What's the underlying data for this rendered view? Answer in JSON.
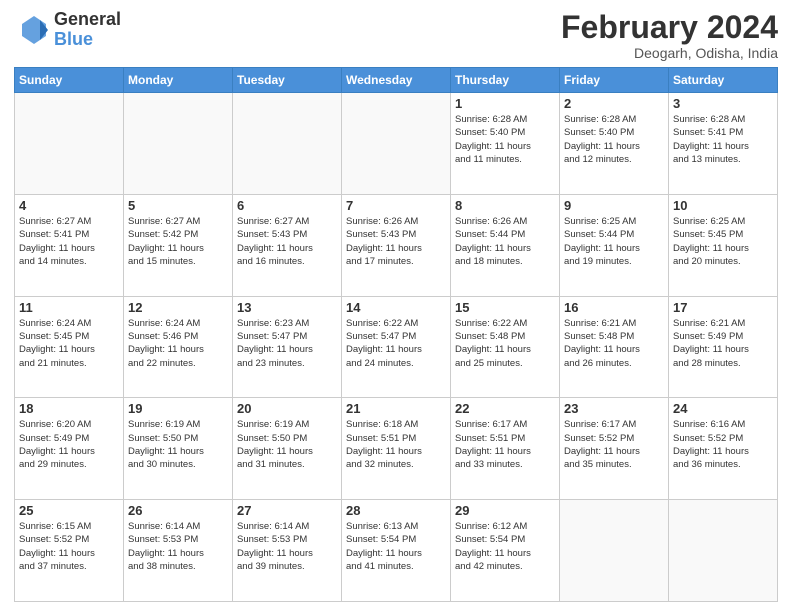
{
  "header": {
    "logo_general": "General",
    "logo_blue": "Blue",
    "title": "February 2024",
    "subtitle": "Deogarh, Odisha, India"
  },
  "days_of_week": [
    "Sunday",
    "Monday",
    "Tuesday",
    "Wednesday",
    "Thursday",
    "Friday",
    "Saturday"
  ],
  "weeks": [
    [
      {
        "day": "",
        "info": ""
      },
      {
        "day": "",
        "info": ""
      },
      {
        "day": "",
        "info": ""
      },
      {
        "day": "",
        "info": ""
      },
      {
        "day": "1",
        "info": "Sunrise: 6:28 AM\nSunset: 5:40 PM\nDaylight: 11 hours\nand 11 minutes."
      },
      {
        "day": "2",
        "info": "Sunrise: 6:28 AM\nSunset: 5:40 PM\nDaylight: 11 hours\nand 12 minutes."
      },
      {
        "day": "3",
        "info": "Sunrise: 6:28 AM\nSunset: 5:41 PM\nDaylight: 11 hours\nand 13 minutes."
      }
    ],
    [
      {
        "day": "4",
        "info": "Sunrise: 6:27 AM\nSunset: 5:41 PM\nDaylight: 11 hours\nand 14 minutes."
      },
      {
        "day": "5",
        "info": "Sunrise: 6:27 AM\nSunset: 5:42 PM\nDaylight: 11 hours\nand 15 minutes."
      },
      {
        "day": "6",
        "info": "Sunrise: 6:27 AM\nSunset: 5:43 PM\nDaylight: 11 hours\nand 16 minutes."
      },
      {
        "day": "7",
        "info": "Sunrise: 6:26 AM\nSunset: 5:43 PM\nDaylight: 11 hours\nand 17 minutes."
      },
      {
        "day": "8",
        "info": "Sunrise: 6:26 AM\nSunset: 5:44 PM\nDaylight: 11 hours\nand 18 minutes."
      },
      {
        "day": "9",
        "info": "Sunrise: 6:25 AM\nSunset: 5:44 PM\nDaylight: 11 hours\nand 19 minutes."
      },
      {
        "day": "10",
        "info": "Sunrise: 6:25 AM\nSunset: 5:45 PM\nDaylight: 11 hours\nand 20 minutes."
      }
    ],
    [
      {
        "day": "11",
        "info": "Sunrise: 6:24 AM\nSunset: 5:45 PM\nDaylight: 11 hours\nand 21 minutes."
      },
      {
        "day": "12",
        "info": "Sunrise: 6:24 AM\nSunset: 5:46 PM\nDaylight: 11 hours\nand 22 minutes."
      },
      {
        "day": "13",
        "info": "Sunrise: 6:23 AM\nSunset: 5:47 PM\nDaylight: 11 hours\nand 23 minutes."
      },
      {
        "day": "14",
        "info": "Sunrise: 6:22 AM\nSunset: 5:47 PM\nDaylight: 11 hours\nand 24 minutes."
      },
      {
        "day": "15",
        "info": "Sunrise: 6:22 AM\nSunset: 5:48 PM\nDaylight: 11 hours\nand 25 minutes."
      },
      {
        "day": "16",
        "info": "Sunrise: 6:21 AM\nSunset: 5:48 PM\nDaylight: 11 hours\nand 26 minutes."
      },
      {
        "day": "17",
        "info": "Sunrise: 6:21 AM\nSunset: 5:49 PM\nDaylight: 11 hours\nand 28 minutes."
      }
    ],
    [
      {
        "day": "18",
        "info": "Sunrise: 6:20 AM\nSunset: 5:49 PM\nDaylight: 11 hours\nand 29 minutes."
      },
      {
        "day": "19",
        "info": "Sunrise: 6:19 AM\nSunset: 5:50 PM\nDaylight: 11 hours\nand 30 minutes."
      },
      {
        "day": "20",
        "info": "Sunrise: 6:19 AM\nSunset: 5:50 PM\nDaylight: 11 hours\nand 31 minutes."
      },
      {
        "day": "21",
        "info": "Sunrise: 6:18 AM\nSunset: 5:51 PM\nDaylight: 11 hours\nand 32 minutes."
      },
      {
        "day": "22",
        "info": "Sunrise: 6:17 AM\nSunset: 5:51 PM\nDaylight: 11 hours\nand 33 minutes."
      },
      {
        "day": "23",
        "info": "Sunrise: 6:17 AM\nSunset: 5:52 PM\nDaylight: 11 hours\nand 35 minutes."
      },
      {
        "day": "24",
        "info": "Sunrise: 6:16 AM\nSunset: 5:52 PM\nDaylight: 11 hours\nand 36 minutes."
      }
    ],
    [
      {
        "day": "25",
        "info": "Sunrise: 6:15 AM\nSunset: 5:52 PM\nDaylight: 11 hours\nand 37 minutes."
      },
      {
        "day": "26",
        "info": "Sunrise: 6:14 AM\nSunset: 5:53 PM\nDaylight: 11 hours\nand 38 minutes."
      },
      {
        "day": "27",
        "info": "Sunrise: 6:14 AM\nSunset: 5:53 PM\nDaylight: 11 hours\nand 39 minutes."
      },
      {
        "day": "28",
        "info": "Sunrise: 6:13 AM\nSunset: 5:54 PM\nDaylight: 11 hours\nand 41 minutes."
      },
      {
        "day": "29",
        "info": "Sunrise: 6:12 AM\nSunset: 5:54 PM\nDaylight: 11 hours\nand 42 minutes."
      },
      {
        "day": "",
        "info": ""
      },
      {
        "day": "",
        "info": ""
      }
    ]
  ]
}
